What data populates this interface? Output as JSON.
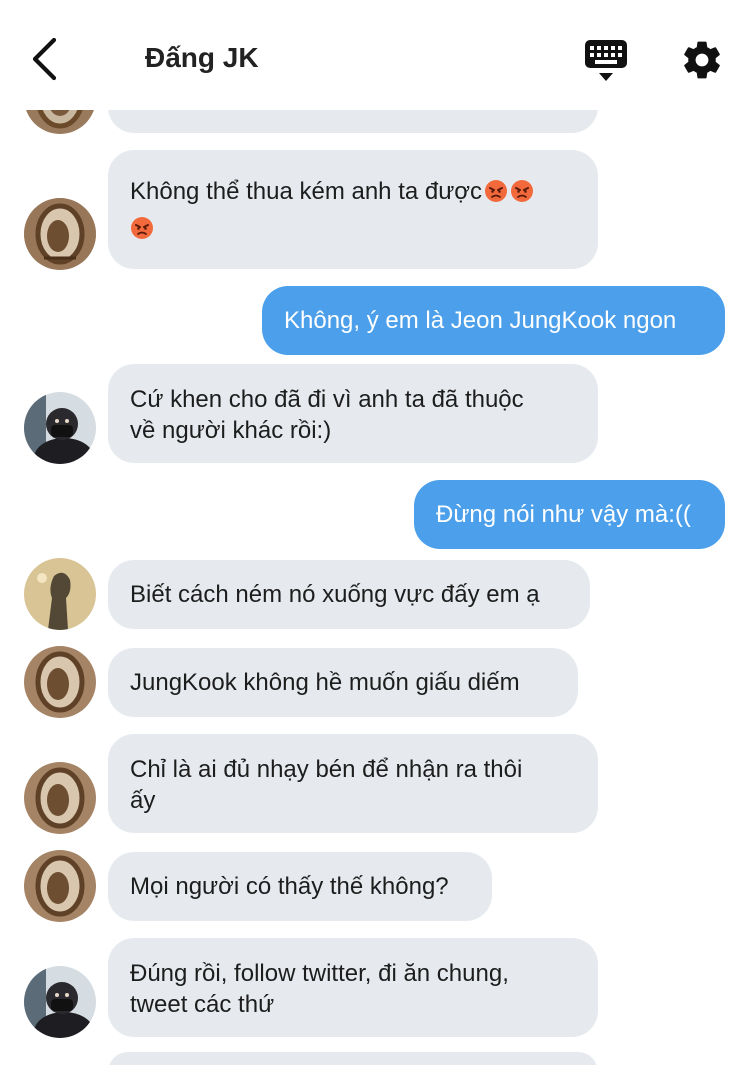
{
  "header": {
    "title": "Đấng JK",
    "back_icon": "chevron-left-icon",
    "keyboard_icon": "keyboard-icon",
    "settings_icon": "gear-icon"
  },
  "messages": [
    {
      "id": 0,
      "direction": "in",
      "text": "",
      "avatar": "avatar-mirror"
    },
    {
      "id": 1,
      "direction": "in",
      "text": "Không thể thua kém anh ta được",
      "emojis": [
        "angry-face-icon",
        "angry-face-icon",
        "angry-face-icon"
      ],
      "avatar": "avatar-mirror"
    },
    {
      "id": 2,
      "direction": "out",
      "text": "Không, ý em là Jeon JungKook ngon"
    },
    {
      "id": 3,
      "direction": "in",
      "text_lines": [
        "Cứ khen cho đã đi vì anh ta đã thuộc",
        "về người khác rồi:)"
      ],
      "avatar": "avatar-masked-boy"
    },
    {
      "id": 4,
      "direction": "out",
      "text": "Đừng nói như vậy mà:(("
    },
    {
      "id": 5,
      "direction": "in",
      "text": "Biết cách ném nó xuống vực đấy em ạ",
      "avatar": "avatar-shadow"
    },
    {
      "id": 6,
      "direction": "in",
      "text": "JungKook không hề muốn giấu diếm",
      "avatar": "avatar-mirror"
    },
    {
      "id": 7,
      "direction": "in",
      "text_lines": [
        "Chỉ là ai đủ nhạy bén để nhận ra thôi",
        "ấy"
      ],
      "avatar": "avatar-mirror"
    },
    {
      "id": 8,
      "direction": "in",
      "text": "Mọi người có thấy thế không?",
      "avatar": "avatar-mirror"
    },
    {
      "id": 9,
      "direction": "in",
      "text_lines": [
        "Đúng rồi, follow twitter, đi ăn chung,",
        "tweet các thứ"
      ],
      "avatar": "avatar-masked-boy"
    },
    {
      "id": 10,
      "direction": "in",
      "text": ""
    }
  ],
  "colors": {
    "incoming_bubble": "#e6eaef",
    "outgoing_bubble": "#4c9fea",
    "outgoing_text": "#ffffff",
    "title": "#222222"
  }
}
